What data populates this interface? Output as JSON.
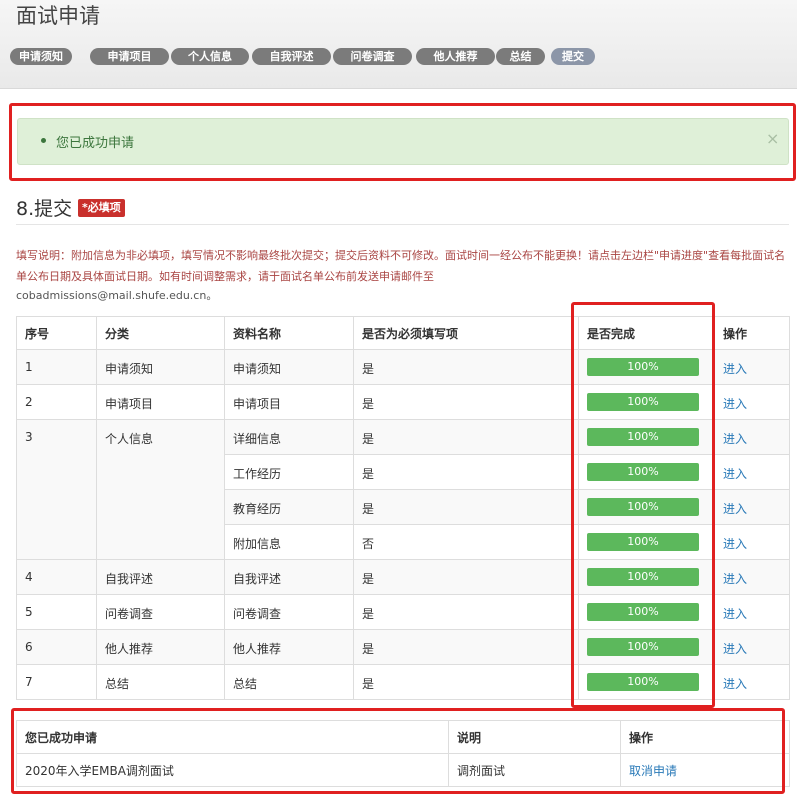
{
  "page_title": "面试申请",
  "steps": [
    {
      "label": "申请须知",
      "active": false
    },
    {
      "label": "申请项目",
      "active": false
    },
    {
      "label": "个人信息",
      "active": false
    },
    {
      "label": "自我评述",
      "active": false
    },
    {
      "label": "问卷调查",
      "active": false
    },
    {
      "label": "他人推荐",
      "active": false
    },
    {
      "label": "总结",
      "active": false
    },
    {
      "label": "提交",
      "active": true
    }
  ],
  "alert": {
    "message": "您已成功申请",
    "close": "×"
  },
  "section": {
    "title": "8.提交",
    "required_badge": "*必填项"
  },
  "instructions": {
    "text": "填写说明：附加信息为非必填项，填写情况不影响最终批次提交；提交后资料不可修改。面试时间一经公布不能更换！请点击左边栏\"申请进度\"查看每批面试名单公布日期及具体面试日期。如有时间调整需求，请于面试名单公布前发送申请邮件至",
    "email": "cobadmissions@mail.shufe.edu.cn。"
  },
  "main_table": {
    "headers": [
      "序号",
      "分类",
      "资料名称",
      "是否为必须填写项",
      "是否完成",
      "操作"
    ],
    "groups": [
      {
        "no": "1",
        "category": "申请须知",
        "items": [
          {
            "name": "申请须知",
            "required": "是",
            "progress": "100%",
            "action": "进入"
          }
        ]
      },
      {
        "no": "2",
        "category": "申请项目",
        "items": [
          {
            "name": "申请项目",
            "required": "是",
            "progress": "100%",
            "action": "进入"
          }
        ]
      },
      {
        "no": "3",
        "category": "个人信息",
        "items": [
          {
            "name": "详细信息",
            "required": "是",
            "progress": "100%",
            "action": "进入"
          },
          {
            "name": "工作经历",
            "required": "是",
            "progress": "100%",
            "action": "进入"
          },
          {
            "name": "教育经历",
            "required": "是",
            "progress": "100%",
            "action": "进入"
          },
          {
            "name": "附加信息",
            "required": "否",
            "progress": "100%",
            "action": "进入"
          }
        ]
      },
      {
        "no": "4",
        "category": "自我评述",
        "items": [
          {
            "name": "自我评述",
            "required": "是",
            "progress": "100%",
            "action": "进入"
          }
        ]
      },
      {
        "no": "5",
        "category": "问卷调查",
        "items": [
          {
            "name": "问卷调查",
            "required": "是",
            "progress": "100%",
            "action": "进入"
          }
        ]
      },
      {
        "no": "6",
        "category": "他人推荐",
        "items": [
          {
            "name": "他人推荐",
            "required": "是",
            "progress": "100%",
            "action": "进入"
          }
        ]
      },
      {
        "no": "7",
        "category": "总结",
        "items": [
          {
            "name": "总结",
            "required": "是",
            "progress": "100%",
            "action": "进入"
          }
        ]
      }
    ]
  },
  "application_table": {
    "headers": [
      "您已成功申请",
      "说明",
      "操作"
    ],
    "rows": [
      {
        "name": "2020年入学EMBA调剂面试",
        "note": "调剂面试",
        "action": "取消申请"
      }
    ]
  },
  "colors": {
    "highlight": "#e02020",
    "progress": "#5cb85c",
    "link": "#2a7ab8",
    "alert_bg": "#dff0d8",
    "badge": "#c9302c"
  }
}
